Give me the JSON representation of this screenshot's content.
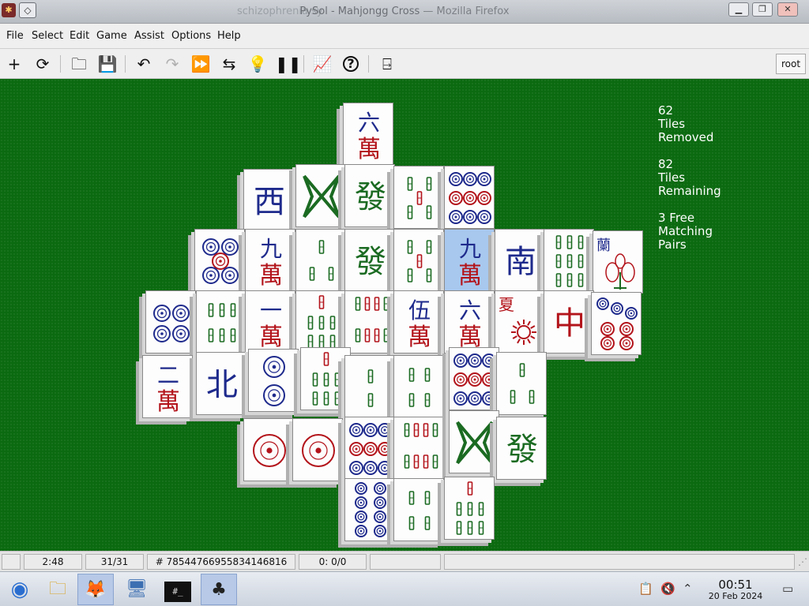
{
  "window": {
    "title": "PySol - Mahjongg Cross",
    "ghost_title": "schizophrenia sy",
    "browser_suffix": "— Mozilla Firefox",
    "pin_symbol": "◇",
    "minimize": "▁",
    "maximize": "❐",
    "close": "✕"
  },
  "menu": [
    "File",
    "Select",
    "Edit",
    "Game",
    "Assist",
    "Options",
    "Help"
  ],
  "toolbar": {
    "icons": [
      "new-game-icon",
      "restart-icon",
      "open-icon",
      "save-icon",
      "undo-icon",
      "redo-icon",
      "autodrop-icon",
      "shuffle-icon",
      "hint-icon",
      "pause-icon",
      "statistics-icon",
      "rules-icon",
      "quit-icon"
    ],
    "glyphs": [
      "+",
      "⟳",
      "🗀",
      "💾",
      "↶",
      "↷",
      "⏩",
      "⇆",
      "💡",
      "❚❚",
      "📈",
      "?",
      "⍈"
    ],
    "user": "root"
  },
  "stats": {
    "removed": "62",
    "removed_label1": "Tiles",
    "removed_label2": "Removed",
    "remaining": "82",
    "remaining_label1": "Tiles",
    "remaining_label2": "Remaining",
    "free_pairs": "3 Free",
    "free_label1": "Matching",
    "free_label2": "Pairs"
  },
  "tiles": [
    {
      "kind": "char",
      "number": "六",
      "suit": "萬"
    },
    {
      "kind": "wind",
      "glyph": "西",
      "color": "#1e2a8c"
    },
    {
      "kind": "bamboo",
      "count": 1
    },
    {
      "kind": "dragon",
      "glyph": "發",
      "color": "#1b6b22"
    },
    {
      "kind": "bamboo",
      "count": 5
    },
    {
      "kind": "circles",
      "count": 9
    },
    {
      "kind": "circles",
      "count": 5
    },
    {
      "kind": "char",
      "number": "九",
      "suit": "萬"
    },
    {
      "kind": "bamboo",
      "count": 3
    },
    {
      "kind": "dragon",
      "glyph": "發",
      "color": "#1b6b22"
    },
    {
      "kind": "bamboo",
      "count": 5
    },
    {
      "kind": "char",
      "number": "九",
      "suit": "萬",
      "selected": true
    },
    {
      "kind": "wind",
      "glyph": "南",
      "color": "#1e2a8c"
    },
    {
      "kind": "bamboo",
      "count": 9
    },
    {
      "kind": "flower",
      "label": "蘭"
    },
    {
      "kind": "circles",
      "count": 4
    },
    {
      "kind": "bamboo",
      "count": 6
    },
    {
      "kind": "char",
      "number": "一",
      "suit": "萬"
    },
    {
      "kind": "bamboo",
      "count": 7
    },
    {
      "kind": "bamboo",
      "count": 8
    },
    {
      "kind": "char",
      "number": "伍",
      "suit": "萬"
    },
    {
      "kind": "char",
      "number": "六",
      "suit": "萬"
    },
    {
      "kind": "season",
      "label": "夏"
    },
    {
      "kind": "dragon",
      "glyph": "中",
      "color": "#b3141b"
    },
    {
      "kind": "circles",
      "count": 7
    },
    {
      "kind": "char",
      "number": "二",
      "suit": "萬"
    },
    {
      "kind": "wind",
      "glyph": "北",
      "color": "#1e2a8c"
    },
    {
      "kind": "circles",
      "count": 2
    },
    {
      "kind": "bamboo",
      "count": 7
    },
    {
      "kind": "bamboo",
      "count": 2
    },
    {
      "kind": "bamboo",
      "count": 4
    },
    {
      "kind": "circles",
      "count": 9
    },
    {
      "kind": "bamboo",
      "count": 3
    },
    {
      "kind": "circles",
      "count": 1
    },
    {
      "kind": "circles",
      "count": 1
    },
    {
      "kind": "circles",
      "count": 9
    },
    {
      "kind": "bamboo",
      "count": 8
    },
    {
      "kind": "bamboo",
      "count": 1
    },
    {
      "kind": "dragon",
      "glyph": "發",
      "color": "#1b6b22"
    },
    {
      "kind": "circles",
      "count": 8
    },
    {
      "kind": "bamboo",
      "count": 4
    },
    {
      "kind": "bamboo",
      "count": 7
    }
  ],
  "status": {
    "time": "2:48",
    "moves": "31/31",
    "game_number": "# 78544766955834146816",
    "score": "0: 0/0",
    "empty1": "",
    "empty2": ""
  },
  "taskbar": {
    "apps": [
      "start-orb-icon",
      "file-manager-icon",
      "firefox-icon",
      "control-panel-icon",
      "terminal-icon",
      "pysol-icon"
    ],
    "glyphs": [
      "◉",
      "🗀",
      "🦊",
      "🖥",
      "#",
      "♣"
    ],
    "terminal_label": "#_",
    "clock_time": "00:51",
    "clock_date": "20 Feb 2024"
  }
}
